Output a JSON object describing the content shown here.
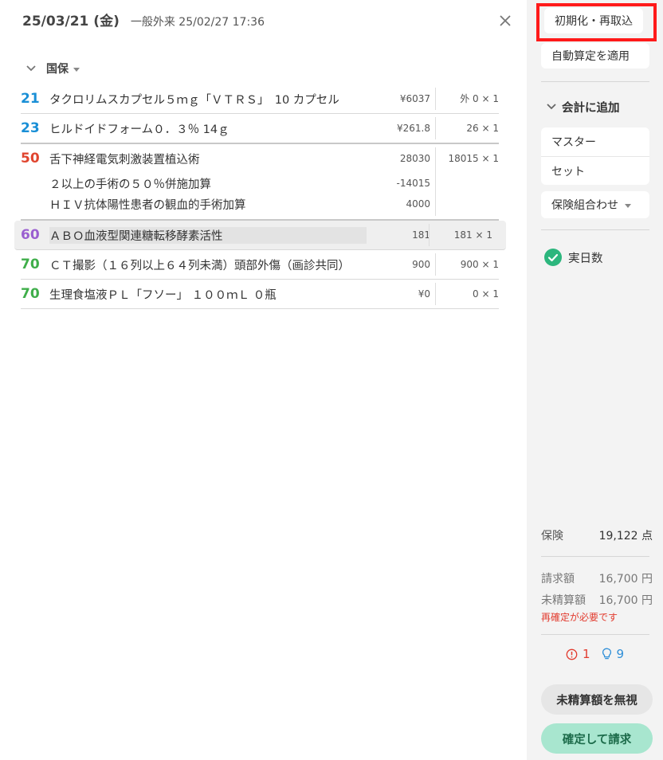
{
  "header": {
    "date": "25/03/21 (金)",
    "visit_type": "一般外来 25/02/27 17:36"
  },
  "section": {
    "label": "国保"
  },
  "rows": [
    {
      "code": "21",
      "code_color": "#1a8fd6",
      "lines": [
        {
          "name": "タクロリムスカプセル５ｍｇ「ＶＴＲＳ」　10 カプセル",
          "price": "¥6037"
        }
      ],
      "qty": "外 0 × 1"
    },
    {
      "code": "23",
      "code_color": "#1a8fd6",
      "lines": [
        {
          "name": "ヒルドイドフォーム０．３％ 14ｇ",
          "price": "¥261.8"
        }
      ],
      "qty": "26 × 1"
    },
    {
      "code": "50",
      "code_color": "#e0452f",
      "lines": [
        {
          "name": "舌下神経電気刺激装置植込術",
          "price": "28030"
        },
        {
          "name": "２以上の手術の５０％併施加算",
          "price": "-14015"
        },
        {
          "name": "ＨＩＶ抗体陽性患者の観血的手術加算",
          "price": "4000"
        }
      ],
      "qty": "18015 × 1"
    },
    {
      "code": "60",
      "code_color": "#9a5fd0",
      "lines": [
        {
          "name": "ＡＢＯ血液型関連糖転移酵素活性",
          "price": "181"
        }
      ],
      "qty": "181 × 1"
    },
    {
      "code": "70",
      "code_color": "#3fae4a",
      "lines": [
        {
          "name": "ＣＴ撮影（１６列以上６４列未満）頭部外傷（画診共同）",
          "price": "900"
        }
      ],
      "qty": "900 × 1"
    },
    {
      "code": "70",
      "code_color": "#3fae4a",
      "lines": [
        {
          "name": "生理食塩液ＰＬ「フソー」 １００ｍＬ ０瓶",
          "price": "¥0"
        }
      ],
      "qty": "0 × 1"
    }
  ],
  "sidebar": {
    "init_button": "初期化・再取込",
    "auto_button": "自動算定を適用",
    "add_section": "会計に追加",
    "menu_items": [
      "マスター",
      "セット"
    ],
    "combo_button": "保険組合わせ",
    "check_label": "実日数",
    "insurance_label": "保険",
    "insurance_value": "19,122 点",
    "billed_label": "請求額",
    "billed_value": "16,700 円",
    "unsettled_label": "未精算額",
    "unsettled_value": "16,700 円",
    "warning": "再確定が必要です",
    "alert_count": "1",
    "hint_count": "9",
    "ignore_button": "未精算額を無視",
    "confirm_button": "確定して請求"
  },
  "colors": {
    "accent_green": "#2cb67d",
    "confirm_bg": "#a8e6cf",
    "confirm_text": "#1c6b4a",
    "alert_red": "#e23b2e",
    "hint_blue": "#2f8fd8",
    "highlight_outline": "#ff1a1a"
  }
}
